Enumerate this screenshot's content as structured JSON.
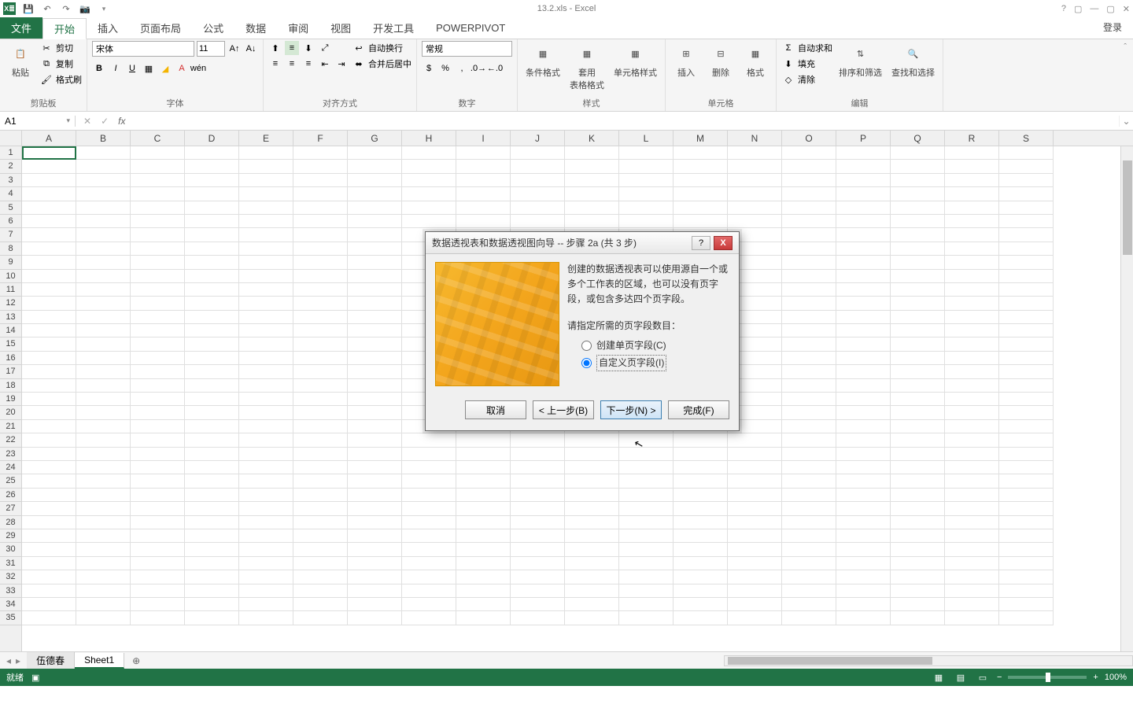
{
  "app": {
    "title": "13.2.xls - Excel",
    "login": "登录"
  },
  "qat": {
    "save": "💾",
    "undo": "↶",
    "redo": "↷",
    "camera": "📷"
  },
  "tabs": {
    "file": "文件",
    "home": "开始",
    "insert": "插入",
    "page_layout": "页面布局",
    "formulas": "公式",
    "data": "数据",
    "review": "审阅",
    "view": "视图",
    "developer": "开发工具",
    "powerpivot": "POWERPIVOT"
  },
  "ribbon": {
    "clipboard": {
      "label": "剪贴板",
      "paste": "粘贴",
      "cut": "剪切",
      "copy": "复制",
      "format_painter": "格式刷"
    },
    "font": {
      "label": "字体",
      "name": "宋体",
      "size": "11"
    },
    "alignment": {
      "label": "对齐方式",
      "wrap": "自动换行",
      "merge": "合并后居中"
    },
    "number": {
      "label": "数字",
      "format": "常规"
    },
    "styles": {
      "label": "样式",
      "cond_fmt": "条件格式",
      "table_fmt": "套用\n表格格式",
      "cell_styles": "单元格样式"
    },
    "cells": {
      "label": "单元格",
      "insert": "插入",
      "delete": "删除",
      "format": "格式"
    },
    "editing": {
      "label": "编辑",
      "autosum": "自动求和",
      "fill": "填充",
      "clear": "清除",
      "sort_filter": "排序和筛选",
      "find_select": "查找和选择"
    }
  },
  "name_box": "A1",
  "columns": [
    "A",
    "B",
    "C",
    "D",
    "E",
    "F",
    "G",
    "H",
    "I",
    "J",
    "K",
    "L",
    "M",
    "N",
    "O",
    "P",
    "Q",
    "R",
    "S"
  ],
  "row_count": 35,
  "sheets": {
    "tab1": "伍德春",
    "tab2": "Sheet1",
    "add": "⊕"
  },
  "statusbar": {
    "ready": "就绪",
    "zoom": "100%"
  },
  "wizard": {
    "title": "数据透视表和数据透视图向导 -- 步骤 2a (共 3 步)",
    "description": "创建的数据透视表可以使用源自一个或多个工作表的区域，也可以没有页字段，或包含多达四个页字段。",
    "prompt": "请指定所需的页字段数目：",
    "option1": "创建单页字段(C)",
    "option2": "自定义页字段(I)",
    "cancel": "取消",
    "back": "< 上一步(B)",
    "next": "下一步(N) >",
    "finish": "完成(F)",
    "help": "?",
    "close": "X"
  }
}
